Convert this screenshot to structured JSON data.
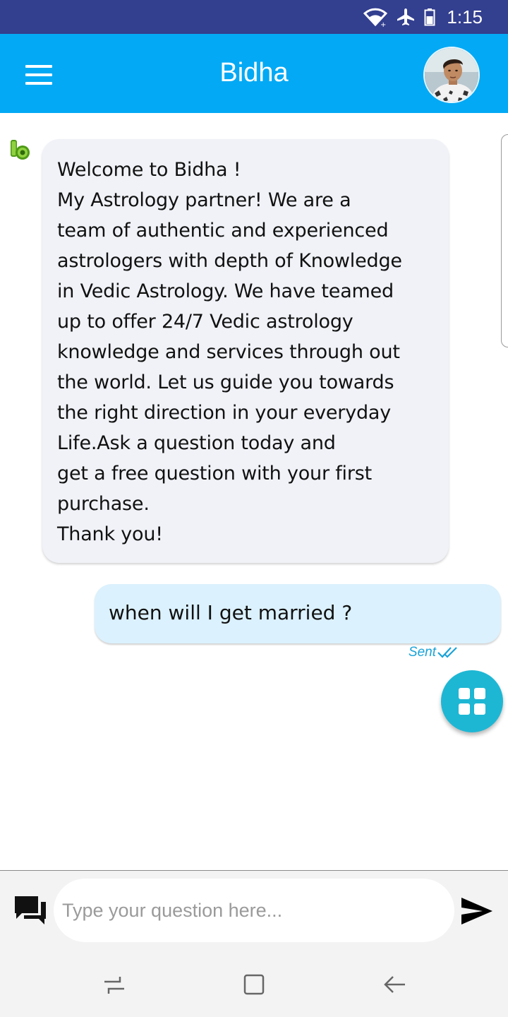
{
  "status_bar": {
    "time": "1:15",
    "icons": [
      "wifi-icon",
      "airplane-icon",
      "battery-icon"
    ],
    "background": "#333f8f"
  },
  "app_bar": {
    "title": "Bidha",
    "menu_icon": "hamburger-menu-icon",
    "avatar": "user-avatar",
    "background": "#03a9f4"
  },
  "chat": {
    "messages": [
      {
        "sender": "bot",
        "text": "Welcome to Bidha !\nMy Astrology partner! We are a\nteam of authentic and experienced\nastrologers with depth of Knowledge\nin Vedic Astrology. We have teamed\nup to offer 24/7 Vedic astrology\nknowledge and services through out\nthe world. Let us guide you towards\nthe right direction in your everyday\nLife.Ask a question today and\nget a free question with your first\npurchase.\nThank you!"
      },
      {
        "sender": "user",
        "text": "when will I get married ?",
        "status": "Sent"
      }
    ],
    "bot_bubble_color": "#f0f2f7",
    "user_bubble_color": "#dbf1fd",
    "status_color": "#1aa3d8"
  },
  "fab": {
    "icon": "grid-apps-icon",
    "color": "#1db7d4"
  },
  "composer": {
    "placeholder": "Type your question here...",
    "value": "",
    "left_icon": "chat-bubbles-icon",
    "send_icon": "send-icon"
  },
  "nav_bar": {
    "icons": [
      "recents-icon",
      "home-icon",
      "back-icon"
    ]
  }
}
